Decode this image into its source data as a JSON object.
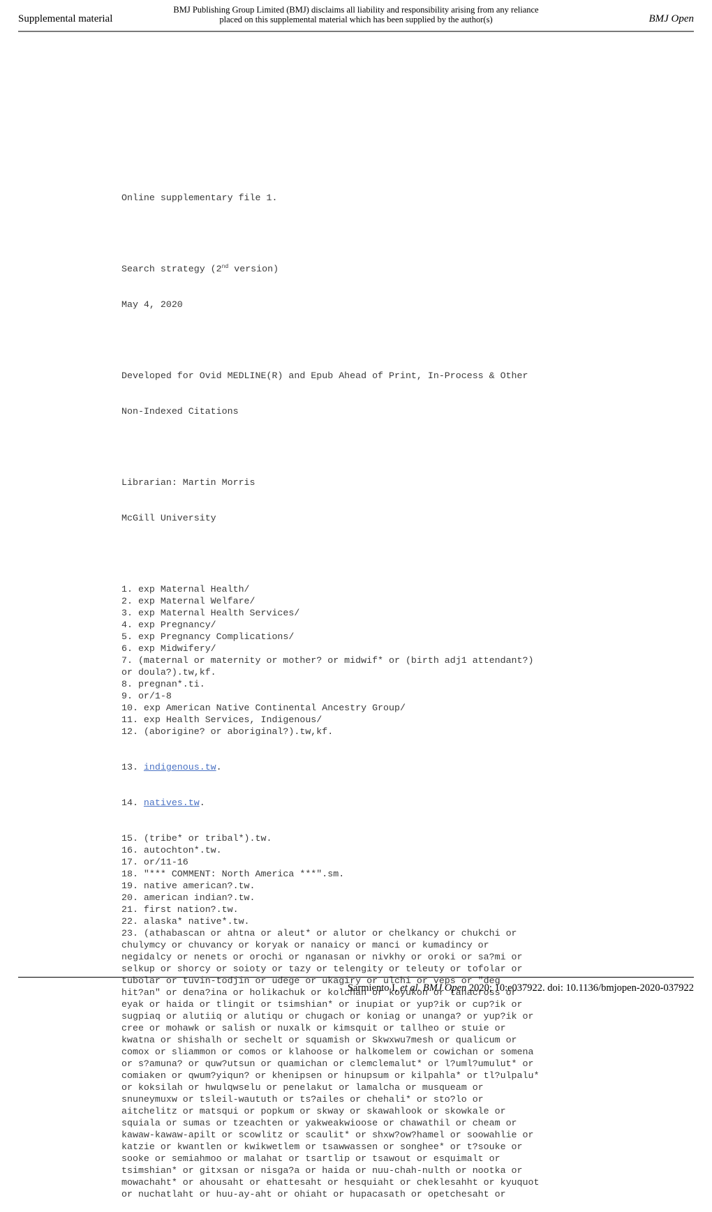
{
  "header": {
    "left": "Supplemental material",
    "disclaimer_line1": "BMJ Publishing Group Limited (BMJ) disclaims all liability and responsibility arising from any reliance",
    "disclaimer_line2": "placed on this supplemental material which has been supplied by the author(s)",
    "right": "BMJ Open"
  },
  "document": {
    "title": "Online supplementary file 1.",
    "strategy_prefix": "Search strategy (2",
    "strategy_sup": "nd",
    "strategy_suffix": " version)",
    "date": "May 4, 2020",
    "developed_line1": "Developed for Ovid MEDLINE(R) and Epub Ahead of Print, In-Process & Other",
    "developed_line2": "Non-Indexed Citations",
    "librarian": "Librarian: Martin Morris",
    "institution": "McGill University",
    "lines": [
      "1. exp Maternal Health/",
      "2. exp Maternal Welfare/",
      "3. exp Maternal Health Services/",
      "4. exp Pregnancy/",
      "5. exp Pregnancy Complications/",
      "6. exp Midwifery/",
      "7. (maternal or maternity or mother? or midwif* or (birth adj1 attendant?)",
      "or doula?).tw,kf.",
      "8. pregnan*.ti.",
      "9. or/1-8",
      "10. exp American Native Continental Ancestry Group/",
      "11. exp Health Services, Indigenous/",
      "12. (aborigine? or aboriginal?).tw,kf."
    ],
    "line13_num": "13. ",
    "line13_link": "indigenous.tw",
    "line13_end": ".",
    "line14_num": "14. ",
    "line14_link": "natives.tw",
    "line14_end": ".",
    "lines_after": [
      "15. (tribe* or tribal*).tw.",
      "16. autochton*.tw.",
      "17. or/11-16",
      "18. \"*** COMMENT: North America ***\".sm.",
      "19. native american?.tw.",
      "20. american indian?.tw.",
      "21. first nation?.tw.",
      "22. alaska* native*.tw.",
      "23. (athabascan or ahtna or aleut* or alutor or chelkancy or chukchi or",
      "chulymcy or chuvancy or koryak or nanaicy or manci or kumadincy or",
      "negidalcy or nenets or orochi or nganasan or nivkhy or oroki or sa?mi or",
      "selkup or shorcy or soioty or tazy or telengity or teleuty or tofolar or",
      "tubolar or tuvin-todjin or udege or ukagiry or ulchi or veps or \"deg",
      "hit?an\" or dena?ina or holikachuk or kolchan or koyukon or tanacross or",
      "eyak or haida or tlingit or tsimshian* or inupiat or yup?ik or cup?ik or",
      "sugpiaq or alutiiq or alutiqu or chugach or koniag or unanga? or yup?ik or",
      "cree or mohawk or salish or nuxalk or kimsquit or tallheo or stuie or",
      "kwatna or shishalh or sechelt or squamish or Skwxwu7mesh or qualicum or",
      "comox or sliammon or comos or klahoose or halkomelem or cowichan or somena",
      "or s?amuna? or quw?utsun or quamichan or clemclemalut* or l?uml?umulut* or",
      "comiaken or qwum?yiqun? or khenipsen or hinupsum or kilpahla* or tl?ulpalu*",
      "or koksilah or hwulqwselu or penelakut or lamalcha or musqueam or",
      "snuneymuxw or tsleil-waututh or ts?ailes or chehali* or sto?lo or",
      "aitchelitz or matsqui or popkum or skway or skawahlook or skowkale or",
      "squiala or sumas or tzeachten or yakweakwioose or chawathil or cheam or",
      "kawaw-kawaw-apilt or scowlitz or scaulit* or shxw?ow?hamel or soowahlie or",
      "katzie or kwantlen or kwikwetlem or tsawwassen or songhee* or t?souke or",
      "sooke or semiahmoo or malahat or tsartlip or tsawout or esquimalt or",
      "tsimshian* or gitxsan or nisga?a or haida or nuu-chah-nulth or nootka or",
      "mowachaht* or ahousaht or ehattesaht or hesquiaht or cheklesahht or kyuquot",
      "or nuchatlaht or huu-ay-aht or ohiaht or hupacasath or opetchesaht or"
    ]
  },
  "footer": {
    "authors": "Sarmiento I, ",
    "etal": "et al.",
    "journal": " BMJ Open",
    "citation": " 2020; 10:e037922. doi: 10.1136/bmjopen-2020-037922"
  },
  "colors": {
    "link": "#4a72c4",
    "body_text": "#3a3a3a",
    "header_rule": "#7a7a7a"
  }
}
